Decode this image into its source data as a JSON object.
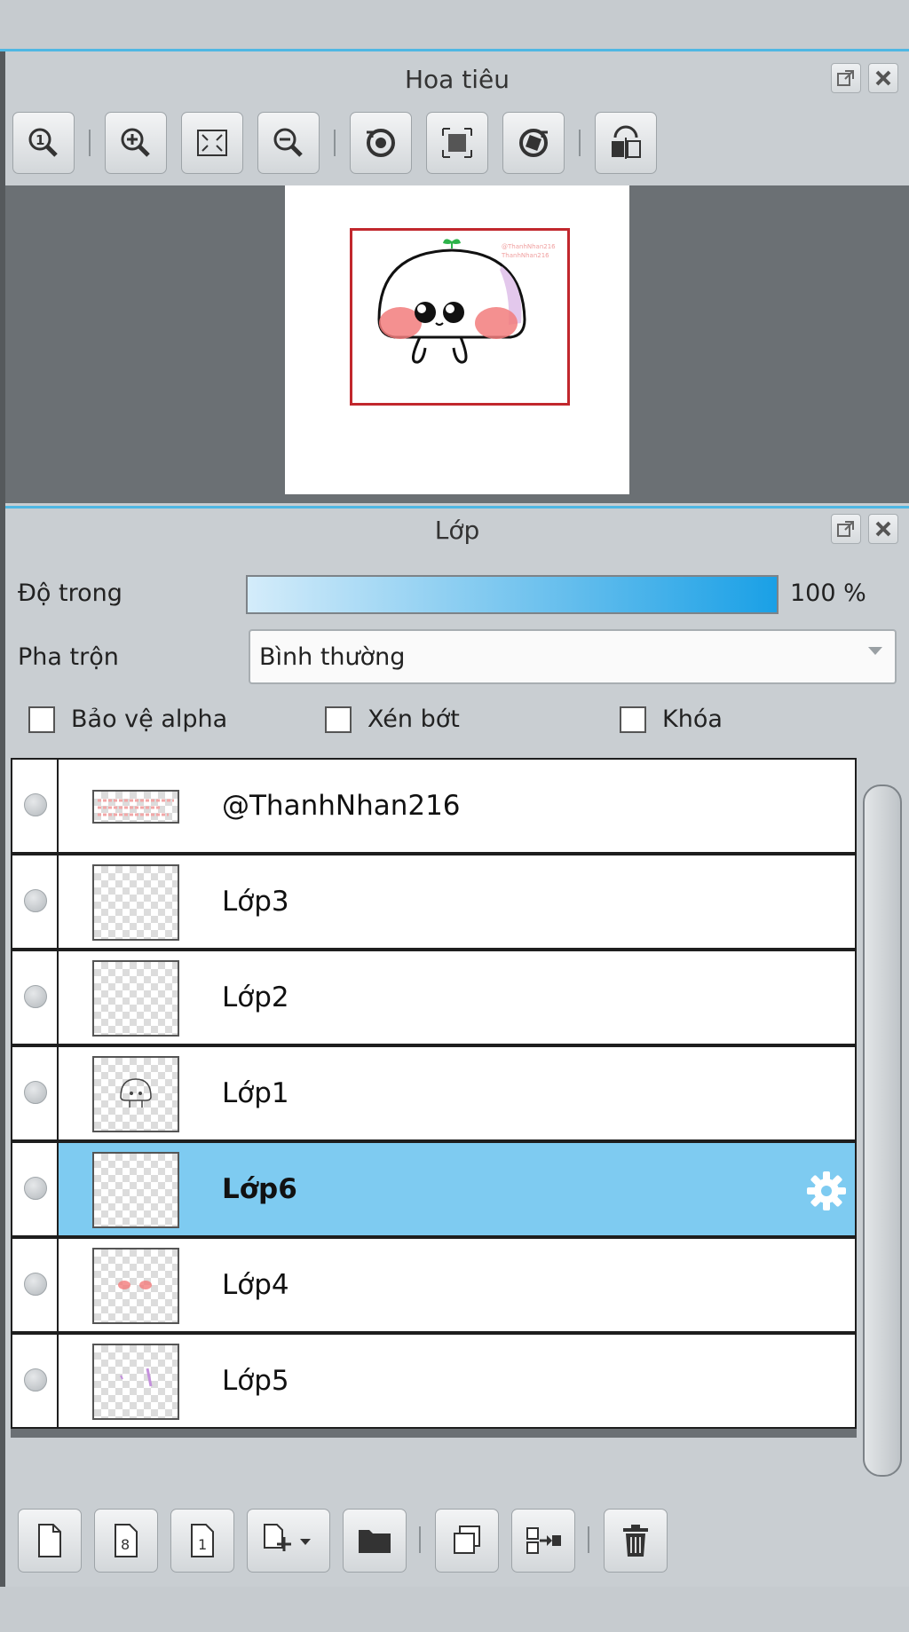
{
  "navigator": {
    "title": "Hoa tiêu",
    "header_buttons": [
      "popout-icon",
      "close-icon"
    ],
    "toolbar": [
      "zoom-actual-icon",
      "zoom-in-icon",
      "fit-screen-icon",
      "zoom-out-icon",
      "rotate-left-icon",
      "fit-frame-icon",
      "rotate-right-icon",
      "flip-horizontal-icon"
    ]
  },
  "layers": {
    "title": "Lớp",
    "opacity_label": "Độ trong",
    "opacity_value": "100 %",
    "opacity": 1.0,
    "blend_label": "Pha trộn",
    "blend_value": "Bình thường",
    "checkboxes": {
      "alpha": "Bảo vệ alpha",
      "clip": "Xén bớt",
      "lock": "Khóa"
    },
    "items": [
      {
        "name": "@ThanhNhan216",
        "selected": false
      },
      {
        "name": "Lớp3",
        "selected": false
      },
      {
        "name": "Lớp2",
        "selected": false
      },
      {
        "name": "Lớp1",
        "selected": false
      },
      {
        "name": "Lớp6",
        "selected": true
      },
      {
        "name": "Lớp4",
        "selected": false
      },
      {
        "name": "Lớp5",
        "selected": false
      }
    ],
    "bottom_toolbar": [
      "new-layer-icon",
      "new-8bit-layer-icon",
      "new-1bit-layer-icon",
      "add-layer-menu-icon",
      "new-folder-icon",
      "duplicate-layer-icon",
      "merge-down-icon",
      "delete-layer-icon"
    ]
  },
  "colors": {
    "accent": "#4fb7e3",
    "selection": "#7ecbf1",
    "frame": "#c1272d"
  }
}
